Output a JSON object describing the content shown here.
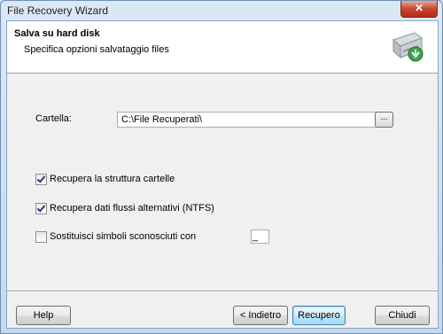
{
  "window": {
    "title": "File Recovery Wizard",
    "close_label": "✕"
  },
  "header": {
    "title": "Salva su hard disk",
    "subtitle": "Specifica opzioni salvataggio files",
    "icon": "hard-disk-icon"
  },
  "folder": {
    "label": "Cartella:",
    "value": "C:\\File Recuperati\\",
    "browse_label": "..."
  },
  "options": [
    {
      "label": "Recupera la struttura cartelle",
      "checked": true
    },
    {
      "label": "Recupera dati flussi alternativi (NTFS)",
      "checked": true
    },
    {
      "label": "Sostituisci simboli sconosciuti con",
      "checked": false
    }
  ],
  "replace_char": "_",
  "buttons": {
    "help": "Help",
    "back": "< Indietro",
    "recover": "Recupero",
    "close": "Chiudi"
  }
}
